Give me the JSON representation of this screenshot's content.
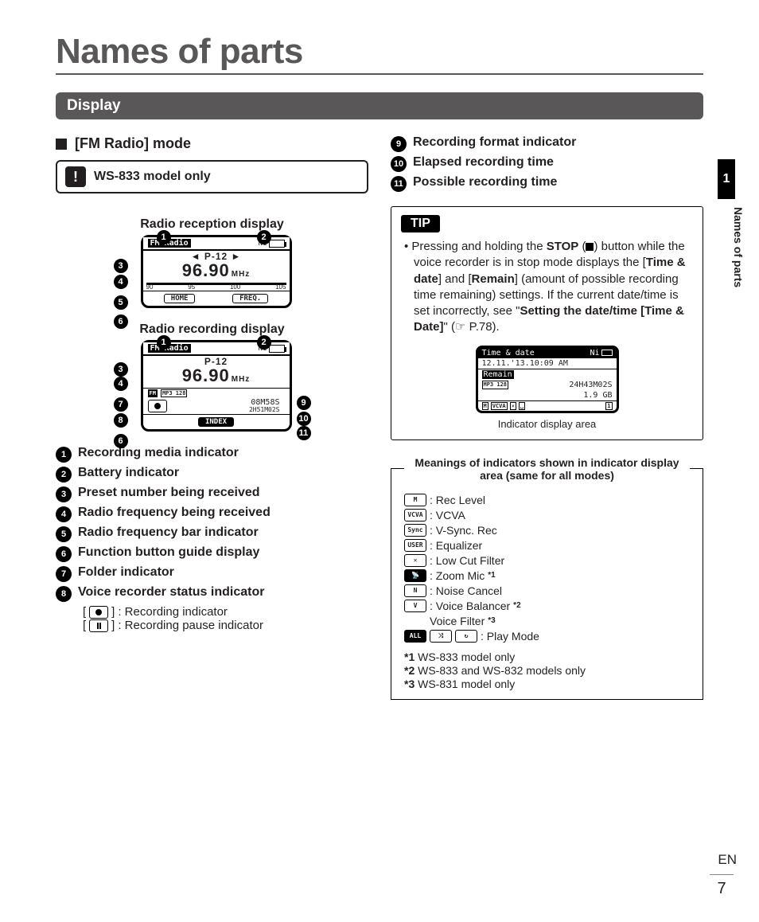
{
  "page": {
    "title": "Names of parts",
    "subsection": "Display",
    "side_tab": "Names of parts",
    "side_index": "1",
    "lang": "EN",
    "number": "7"
  },
  "left": {
    "mode_heading": "[FM Radio] mode",
    "model_note": "WS-833 model only",
    "reception_title": "Radio reception display",
    "recording_title": "Radio recording display",
    "lcd": {
      "mode_label": "FM Radio",
      "batt_label": "Ni",
      "preset": "P-12",
      "frequency": "96.90",
      "freq_unit": "MHz",
      "ticks": [
        "90",
        "95",
        "100",
        "105"
      ],
      "fn_home": "HOME",
      "fn_freq": "FREQ.",
      "fn_index": "INDEX",
      "folder": "FM",
      "format": "MP3 128",
      "elapsed": "08M58S",
      "remain": "2H51M02S"
    },
    "legend": {
      "i1": "Recording media indicator",
      "i2": "Battery indicator",
      "i3": "Preset number being received",
      "i4": "Radio frequency being received",
      "i5": "Radio frequency bar indicator",
      "i6": "Function button guide display",
      "i7": "Folder indicator",
      "i8": "Voice recorder status indicator",
      "i8a": ": Recording indicator",
      "i8b": ": Recording pause indicator"
    }
  },
  "right": {
    "legend": {
      "i9": "Recording format indicator",
      "i10": "Elapsed recording time",
      "i11": "Possible recording time"
    },
    "tip": {
      "label": "TIP",
      "text_pre": "Pressing and holding the ",
      "stop": "STOP",
      "text_mid1": " (",
      "text_mid2": ") button while the voice recorder is in stop mode displays the [",
      "time_date": "Time & date",
      "text_mid3": "] and [",
      "remain": "Remain",
      "text_mid4": "] (amount of possible recording time remaining) settings. If the current date/time is set incorrectly, see \"",
      "setting": "Setting the date/time [Time & Date]",
      "text_post": "\" (☞ P.78).",
      "lcd": {
        "row1_label": "Time & date",
        "row1_batt": "Ni",
        "row2": "12.11.'13.10:09 AM",
        "row3_label": "Remain",
        "row4_format": "MP3 128",
        "row4_time": "24H43M02S",
        "row5_size": "1.9 GB",
        "row6_ind": "VCVA"
      },
      "caption": "Indicator display area"
    },
    "indicators": {
      "legend_title": "Meanings of indicators shown in indicator display area (same for all modes)",
      "items": {
        "rec_level": ": Rec Level",
        "vcva": ": VCVA",
        "vsync": ": V-Sync. Rec",
        "eq": ": Equalizer",
        "lowcut": ": Low Cut Filter",
        "zoom": ": Zoom Mic",
        "zoom_note": "*1",
        "noise": ": Noise Cancel",
        "vbal": ": Voice Balancer",
        "vbal_note": "*2",
        "vfilter": "Voice Filter",
        "vfilter_note": "*3",
        "play": ": Play Mode"
      },
      "footnotes": {
        "f1_label": "*1",
        "f1": " WS-833 model only",
        "f2_label": "*2",
        "f2": " WS-833 and WS-832 models only",
        "f3_label": "*3",
        "f3": " WS-831 model only"
      }
    }
  }
}
